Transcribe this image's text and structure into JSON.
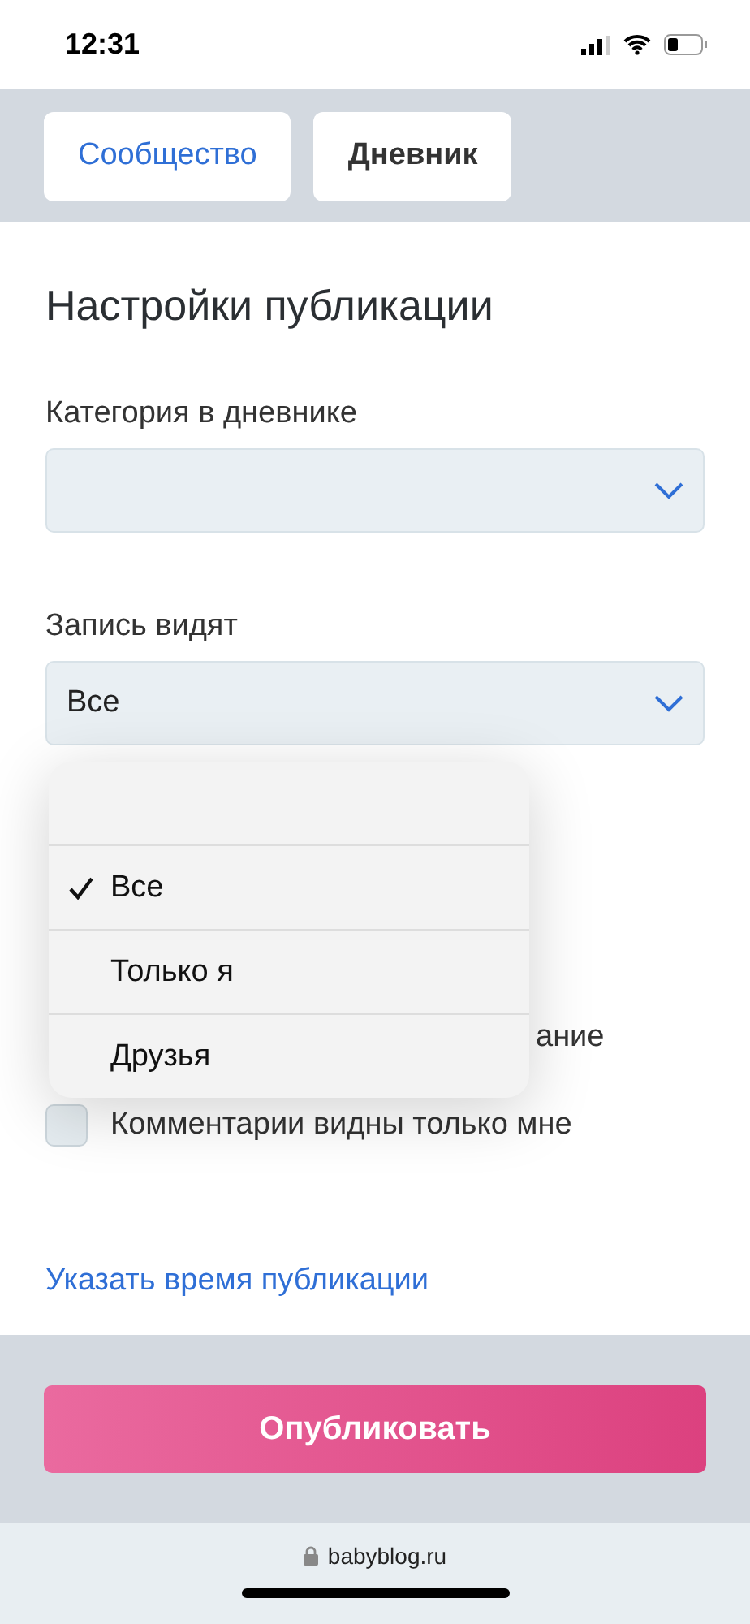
{
  "status_bar": {
    "time": "12:31"
  },
  "tabs": [
    {
      "label": "Сообщество",
      "selected": false
    },
    {
      "label": "Дневник",
      "selected": true
    }
  ],
  "title": "Настройки публикации",
  "fields": [
    {
      "label": "Категория в дневнике"
    },
    {
      "label": "Запись видят",
      "value": "Все"
    }
  ],
  "dropdown": {
    "options": [
      {
        "label": "Все",
        "selected": true
      },
      {
        "label": "Только я",
        "selected": false
      },
      {
        "label": "Друзья",
        "selected": false
      }
    ]
  },
  "checkboxes": [
    {
      "kind": "covered",
      "label": "ание"
    },
    {
      "kind": "checkbox",
      "label": "Комментарии видны только мне",
      "checked": false
    }
  ],
  "link": "Указать время публикации",
  "publish_button": "Опубликовать",
  "address_bar": {
    "url": "babyblog.ru"
  }
}
